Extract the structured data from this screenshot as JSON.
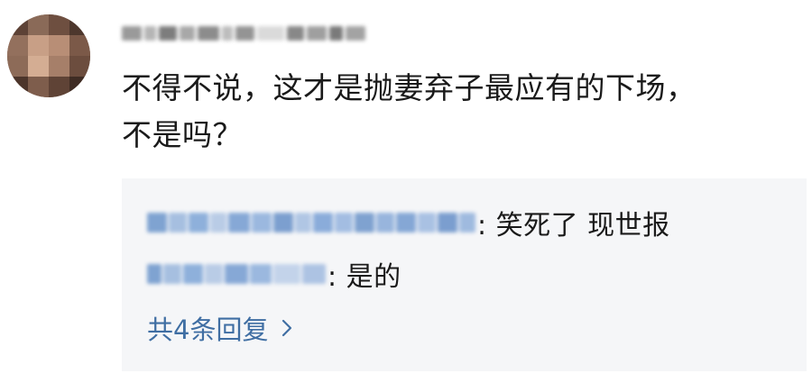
{
  "comment": {
    "text_line1": "不得不说，这才是抛妻弃子最应有的下场，",
    "text_line2": "不是吗？"
  },
  "replies": [
    {
      "text": ": 笑死了 现世报"
    },
    {
      "text": ": 是的"
    }
  ],
  "more_replies_label": "共4条回复",
  "icons": {
    "chevron": "chevron-right-icon"
  },
  "colors": {
    "link": "#3f6ea3",
    "reply_bg": "#f5f6f8",
    "text": "#1a1a1a"
  }
}
